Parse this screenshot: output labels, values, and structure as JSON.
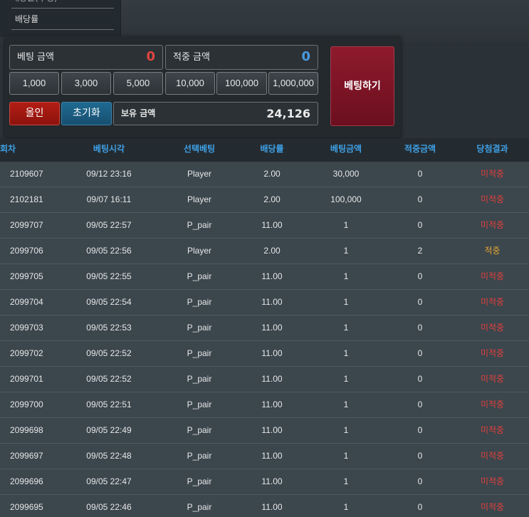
{
  "odds_panel": {
    "prev_label": "배당률(추정)",
    "odds_label": "배당률"
  },
  "bet_panel": {
    "bet_amount_label": "베팅 금액",
    "bet_amount_value": "0",
    "win_amount_label": "적중 금액",
    "win_amount_value": "0",
    "holding_label": "보유 금액",
    "holding_value": "24,126",
    "chips": [
      "1,000",
      "3,000",
      "5,000",
      "10,000",
      "100,000",
      "1,000,000"
    ],
    "allin_label": "올인",
    "reset_label": "초기화",
    "bet_button_label": "베팅하기"
  },
  "history": {
    "headers": [
      "회차",
      "베팅시각",
      "선택베팅",
      "배당률",
      "베팅금액",
      "적중금액",
      "당첨결과"
    ],
    "rows": [
      [
        "2109607",
        "09/12 23:16",
        "Player",
        "2.00",
        "30,000",
        "0",
        "미적중"
      ],
      [
        "2102181",
        "09/07 16:11",
        "Player",
        "2.00",
        "100,000",
        "0",
        "미적중"
      ],
      [
        "2099707",
        "09/05 22:57",
        "P_pair",
        "11.00",
        "1",
        "0",
        "미적중"
      ],
      [
        "2099706",
        "09/05 22:56",
        "Player",
        "2.00",
        "1",
        "2",
        "적중"
      ],
      [
        "2099705",
        "09/05 22:55",
        "P_pair",
        "11.00",
        "1",
        "0",
        "미적중"
      ],
      [
        "2099704",
        "09/05 22:54",
        "P_pair",
        "11.00",
        "1",
        "0",
        "미적중"
      ],
      [
        "2099703",
        "09/05 22:53",
        "P_pair",
        "11.00",
        "1",
        "0",
        "미적중"
      ],
      [
        "2099702",
        "09/05 22:52",
        "P_pair",
        "11.00",
        "1",
        "0",
        "미적중"
      ],
      [
        "2099701",
        "09/05 22:52",
        "P_pair",
        "11.00",
        "1",
        "0",
        "미적중"
      ],
      [
        "2099700",
        "09/05 22:51",
        "P_pair",
        "11.00",
        "1",
        "0",
        "미적중"
      ],
      [
        "2099698",
        "09/05 22:49",
        "P_pair",
        "11.00",
        "1",
        "0",
        "미적중"
      ],
      [
        "2099697",
        "09/05 22:48",
        "P_pair",
        "11.00",
        "1",
        "0",
        "미적중"
      ],
      [
        "2099696",
        "09/05 22:47",
        "P_pair",
        "11.00",
        "1",
        "0",
        "미적중"
      ],
      [
        "2099695",
        "09/05 22:46",
        "P_pair",
        "11.00",
        "1",
        "0",
        "미적중"
      ]
    ]
  },
  "colors": {
    "lose": "#e2403c",
    "win": "#e6a630",
    "header_text": "#3ea0e6"
  }
}
